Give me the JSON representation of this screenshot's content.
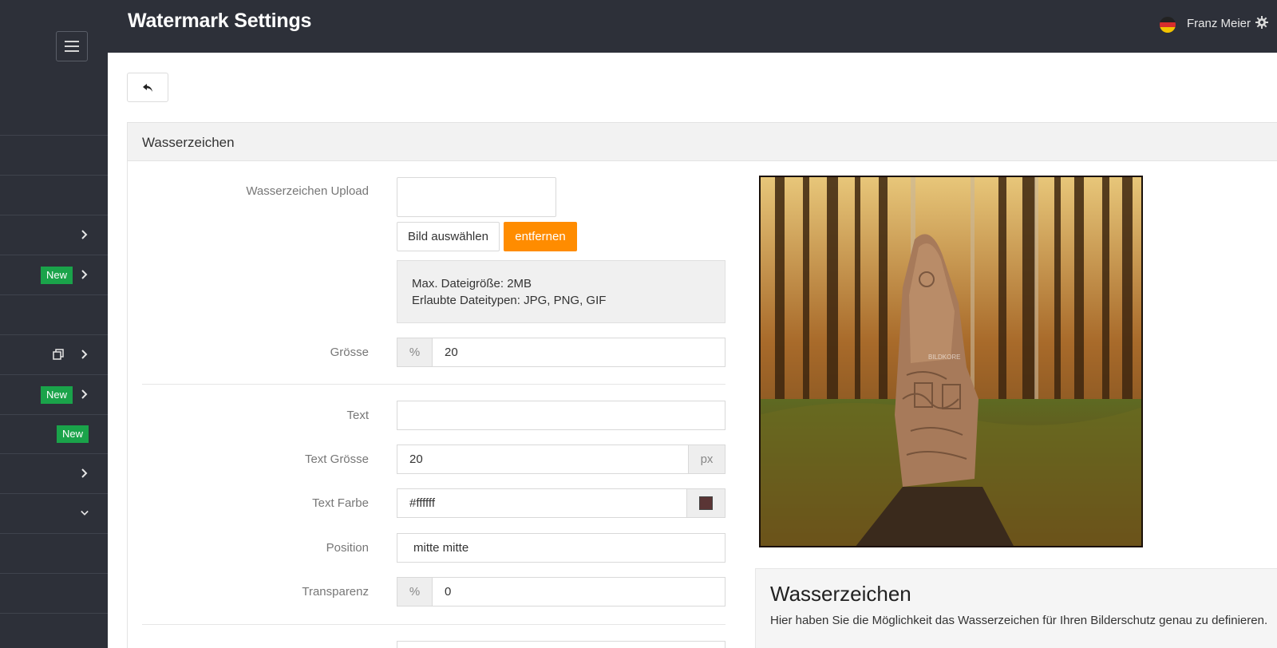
{
  "header": {
    "title": "Watermark Settings",
    "user_name": "Franz Meier",
    "language_flag": "de"
  },
  "sidebar": {
    "items": [
      {
        "chevron": "none",
        "badge": ""
      },
      {
        "chevron": "none",
        "badge": ""
      },
      {
        "chevron": "right",
        "badge": ""
      },
      {
        "chevron": "right",
        "badge": "New"
      },
      {
        "chevron": "none",
        "badge": ""
      },
      {
        "chevron": "right",
        "badge": "",
        "icon": "copy-icon"
      },
      {
        "chevron": "right",
        "badge": "New"
      },
      {
        "chevron": "none",
        "badge": "New"
      },
      {
        "chevron": "right",
        "badge": ""
      },
      {
        "chevron": "down",
        "badge": ""
      },
      {
        "chevron": "none",
        "badge": ""
      },
      {
        "chevron": "none",
        "badge": ""
      }
    ],
    "badge_color": "#1aa34a"
  },
  "panel": {
    "heading": "Wasserzeichen"
  },
  "form": {
    "upload_label": "Wasserzeichen Upload",
    "select_button": "Bild auswählen",
    "remove_button": "entfernen",
    "max_size": "Max. Dateigröße: 2MB",
    "allowed_types": "Erlaubte Dateitypen: JPG, PNG, GIF",
    "size_label": "Grösse",
    "size_addon": "%",
    "size_value": "20",
    "text_label": "Text",
    "text_value": "",
    "text_size_label": "Text Grösse",
    "text_size_value": "20",
    "text_size_unit": "px",
    "text_color_label": "Text Farbe",
    "text_color_value": "#ffffff",
    "swatch_color": "#5a3535",
    "position_label": "Position",
    "position_value": "mitte mitte",
    "transparency_label": "Transparenz",
    "transparency_addon": "%",
    "transparency_value": "0"
  },
  "preview": {
    "watermark_text": "BILDKORE"
  },
  "help": {
    "title": "Wasserzeichen",
    "text": "Hier haben Sie die Möglichkeit das Wasserzeichen für Ihren Bilderschutz genau zu definieren."
  },
  "colors": {
    "sidebar_bg": "#2d3039",
    "accent_orange": "#ff8c00"
  }
}
